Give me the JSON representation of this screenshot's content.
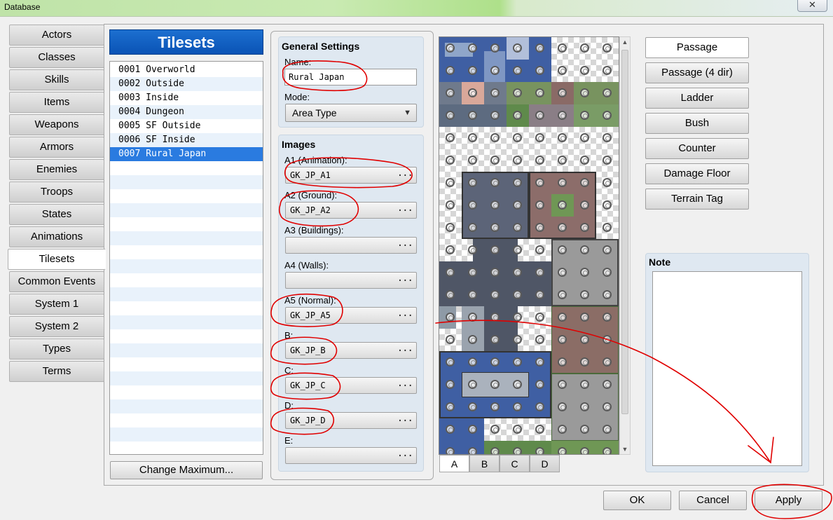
{
  "window": {
    "title": "Database",
    "close_glyph": "✕"
  },
  "categories": [
    {
      "label": "Actors"
    },
    {
      "label": "Classes"
    },
    {
      "label": "Skills"
    },
    {
      "label": "Items"
    },
    {
      "label": "Weapons"
    },
    {
      "label": "Armors"
    },
    {
      "label": "Enemies"
    },
    {
      "label": "Troops"
    },
    {
      "label": "States"
    },
    {
      "label": "Animations"
    },
    {
      "label": "Tilesets"
    },
    {
      "label": "Common Events"
    },
    {
      "label": "System 1"
    },
    {
      "label": "System 2"
    },
    {
      "label": "Types"
    },
    {
      "label": "Terms"
    }
  ],
  "active_category": "Tilesets",
  "tilesets": {
    "header": "Tilesets",
    "items": [
      {
        "text": "0001 Overworld"
      },
      {
        "text": "0002 Outside"
      },
      {
        "text": "0003 Inside"
      },
      {
        "text": "0004 Dungeon"
      },
      {
        "text": "0005 SF Outside"
      },
      {
        "text": "0006 SF Inside"
      },
      {
        "text": "0007 Rural Japan"
      }
    ],
    "selected": "0007 Rural Japan",
    "change_max_label": "Change Maximum..."
  },
  "general": {
    "title": "General Settings",
    "name_label": "Name:",
    "name_value": "Rural Japan",
    "mode_label": "Mode:",
    "mode_value": "Area Type"
  },
  "images": {
    "title": "Images",
    "fields": [
      {
        "label": "A1 (Animation):",
        "value": "GK_JP_A1"
      },
      {
        "label": "A2 (Ground):",
        "value": "GK_JP_A2"
      },
      {
        "label": "A3 (Buildings):",
        "value": ""
      },
      {
        "label": "A4 (Walls):",
        "value": ""
      },
      {
        "label": "A5 (Normal):",
        "value": "GK_JP_A5"
      },
      {
        "label": "B:",
        "value": "GK_JP_B"
      },
      {
        "label": "C:",
        "value": "GK_JP_C"
      },
      {
        "label": "D:",
        "value": "GK_JP_D"
      },
      {
        "label": "E:",
        "value": ""
      }
    ],
    "browse_glyph": "..."
  },
  "palette_tabs": [
    {
      "label": "A"
    },
    {
      "label": "B"
    },
    {
      "label": "C"
    },
    {
      "label": "D"
    }
  ],
  "active_palette_tab": "A",
  "tools": [
    {
      "label": "Passage"
    },
    {
      "label": "Passage (4 dir)"
    },
    {
      "label": "Ladder"
    },
    {
      "label": "Bush"
    },
    {
      "label": "Counter"
    },
    {
      "label": "Damage Floor"
    },
    {
      "label": "Terrain Tag"
    }
  ],
  "active_tool": "Passage",
  "note": {
    "title": "Note",
    "value": ""
  },
  "buttons": {
    "ok": "OK",
    "cancel": "Cancel",
    "apply": "Apply"
  },
  "colors": {
    "header_blue": "#0a53b5",
    "selection_blue": "#2a7be0",
    "panel_bg": "#dfe8f1",
    "annotation_red": "#e00000"
  }
}
